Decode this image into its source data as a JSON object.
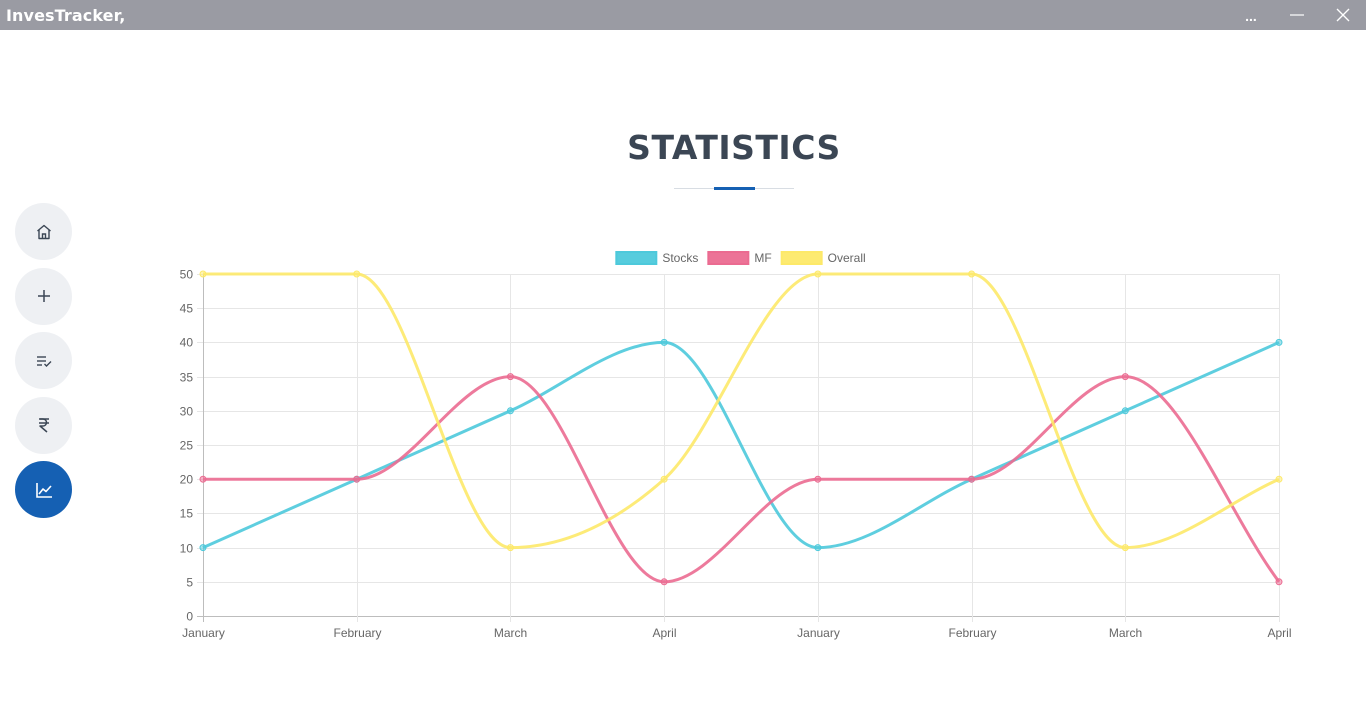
{
  "app": {
    "title": "InvesTracker,"
  },
  "window": {
    "more_label": "..."
  },
  "sidebar": {
    "items": [
      {
        "name": "home",
        "icon": "home-icon"
      },
      {
        "name": "add",
        "icon": "plus-icon"
      },
      {
        "name": "list",
        "icon": "playlist-check-icon"
      },
      {
        "name": "rupee",
        "icon": "rupee-icon"
      },
      {
        "name": "statistics",
        "icon": "chart-line-icon",
        "active": true
      }
    ]
  },
  "page": {
    "title": "STATISTICS"
  },
  "colors": {
    "accent": "#1560b3",
    "titlebar": "#9a9ba3"
  },
  "chart_data": {
    "type": "line",
    "categories": [
      "January",
      "February",
      "March",
      "April",
      "January",
      "February",
      "March",
      "April"
    ],
    "series": [
      {
        "name": "Stocks",
        "values": [
          10,
          20,
          30,
          40,
          10,
          20,
          30,
          40
        ],
        "color": "#4dc9db"
      },
      {
        "name": "MF",
        "values": [
          20,
          20,
          35,
          5,
          20,
          20,
          35,
          5
        ],
        "color": "#eb6b91"
      },
      {
        "name": "Overall",
        "values": [
          50,
          50,
          10,
          20,
          50,
          50,
          10,
          20
        ],
        "color": "#fde969"
      }
    ],
    "ylim": [
      0,
      50
    ],
    "yticks": [
      "0",
      "5",
      "10",
      "15",
      "20",
      "25",
      "30",
      "35",
      "40",
      "45",
      "50"
    ],
    "grid": true,
    "legend": "top-center"
  }
}
